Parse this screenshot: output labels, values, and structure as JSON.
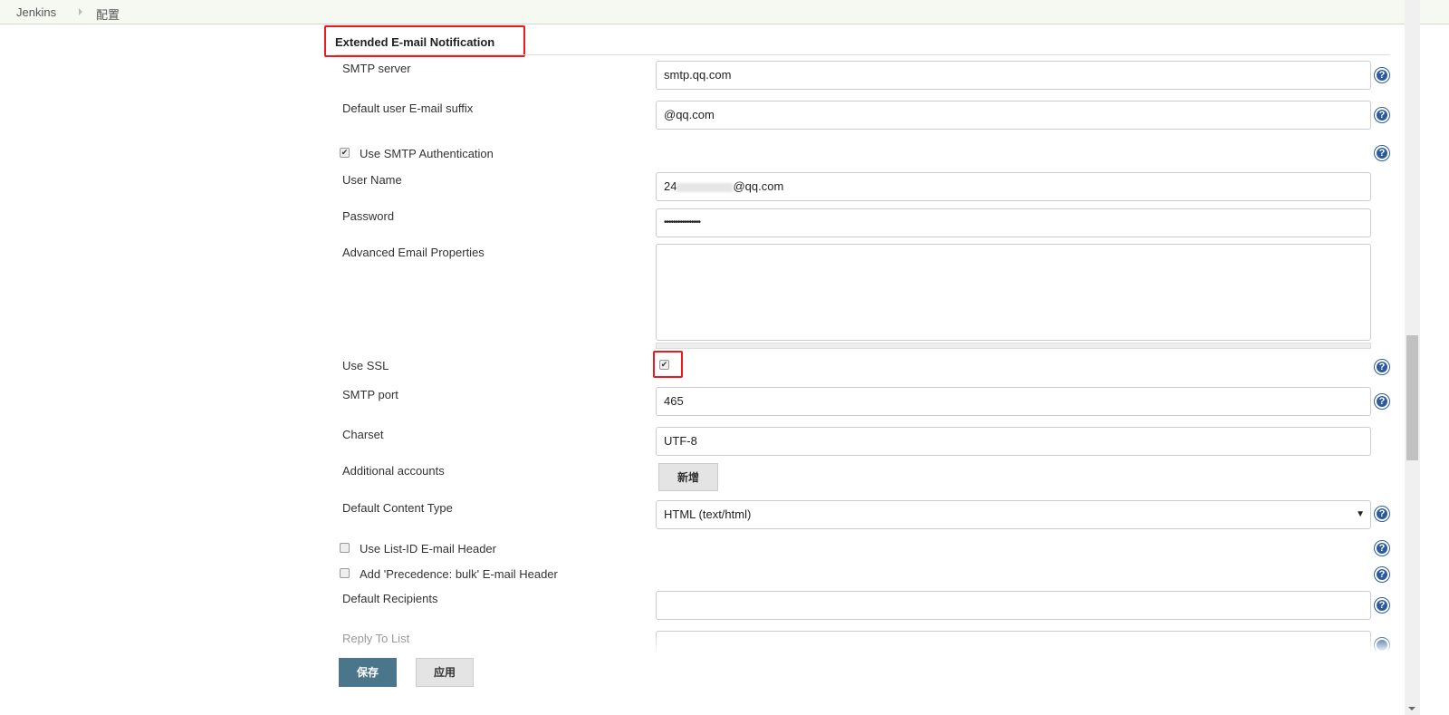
{
  "breadcrumb": {
    "items": [
      "Jenkins",
      "配置"
    ]
  },
  "section": {
    "title": "Extended E-mail Notification"
  },
  "fields": {
    "smtp_server": {
      "label": "SMTP server",
      "value": "smtp.qq.com"
    },
    "email_suffix": {
      "label": "Default user E-mail suffix",
      "value": "@qq.com"
    },
    "use_smtp_auth": {
      "label": "Use SMTP Authentication",
      "checked": true
    },
    "user_name": {
      "label": "User Name",
      "value_prefix": "24",
      "value_suffix": "@qq.com"
    },
    "password": {
      "label": "Password",
      "value": "••••••••••••••••"
    },
    "advanced": {
      "label": "Advanced Email Properties",
      "value": ""
    },
    "use_ssl": {
      "label": "Use SSL",
      "checked": true
    },
    "smtp_port": {
      "label": "SMTP port",
      "value": "465"
    },
    "charset": {
      "label": "Charset",
      "value": "UTF-8"
    },
    "additional_accounts": {
      "label": "Additional accounts",
      "button": "新增"
    },
    "content_type": {
      "label": "Default Content Type",
      "value": "HTML (text/html)"
    },
    "list_id": {
      "label": "Use List-ID E-mail Header",
      "checked": false
    },
    "precedence": {
      "label": "Add 'Precedence: bulk' E-mail Header",
      "checked": false
    },
    "default_recipients": {
      "label": "Default Recipients",
      "value": ""
    },
    "reply_to": {
      "label": "Reply To List",
      "value": ""
    }
  },
  "buttons": {
    "save": "保存",
    "apply": "应用"
  },
  "icons": {
    "help": "help-icon",
    "check": "✔",
    "dropdown": "▼",
    "help_glyph": "?"
  },
  "colors": {
    "save_button": "#4b758b",
    "highlight": "#f01818"
  }
}
